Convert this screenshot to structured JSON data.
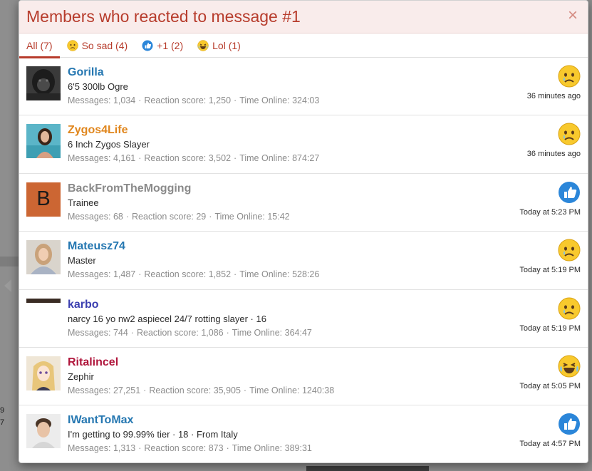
{
  "overlay": {
    "title": "Members who reacted to message #1",
    "close_glyph": "×"
  },
  "tabs": [
    {
      "label": "All (7)",
      "icon": null,
      "active": true
    },
    {
      "label": "So sad (4)",
      "icon": "sad-face-icon",
      "active": false
    },
    {
      "label": "+1 (2)",
      "icon": "thumbs-up-icon",
      "active": false
    },
    {
      "label": "Lol (1)",
      "icon": "laughing-face-icon",
      "active": false
    }
  ],
  "members": [
    {
      "name": "Gorilla",
      "name_color": "#2577b1",
      "title": "6'5 300lb Ogre",
      "messages_label": "Messages:",
      "messages": "1,034",
      "score_label": "Reaction score:",
      "score": "1,250",
      "online_label": "Time Online:",
      "online": "324:03",
      "reaction": "sad-face-icon",
      "time": "36 minutes ago"
    },
    {
      "name": "Zygos4Life",
      "name_color": "#e0861d",
      "title": "6 Inch Zygos Slayer",
      "messages_label": "Messages:",
      "messages": "4,161",
      "score_label": "Reaction score:",
      "score": "3,502",
      "online_label": "Time Online:",
      "online": "874:27",
      "reaction": "sad-face-icon",
      "time": "36 minutes ago"
    },
    {
      "name": "BackFromTheMogging",
      "name_color": "#8a8a8a",
      "title": "Trainee",
      "avatar_letter": "B",
      "messages_label": "Messages:",
      "messages": "68",
      "score_label": "Reaction score:",
      "score": "29",
      "online_label": "Time Online:",
      "online": "15:42",
      "reaction": "thumbs-up-icon",
      "time": "Today at 5:23 PM"
    },
    {
      "name": "Mateusz74",
      "name_color": "#2577b1",
      "title": "Master",
      "messages_label": "Messages:",
      "messages": "1,487",
      "score_label": "Reaction score:",
      "score": "1,852",
      "online_label": "Time Online:",
      "online": "528:26",
      "reaction": "sad-face-icon",
      "time": "Today at 5:19 PM"
    },
    {
      "name": "karbo",
      "name_color": "#3b3fb0",
      "title": "narcy 16 yo nw2 aspiecel 24/7 rotting slayer · 16",
      "messages_label": "Messages:",
      "messages": "744",
      "score_label": "Reaction score:",
      "score": "1,086",
      "online_label": "Time Online:",
      "online": "364:47",
      "reaction": "sad-face-icon",
      "time": "Today at 5:19 PM"
    },
    {
      "name": "Ritalincel",
      "name_color": "#b0163c",
      "title": "Zephir",
      "messages_label": "Messages:",
      "messages": "27,251",
      "score_label": "Reaction score:",
      "score": "35,905",
      "online_label": "Time Online:",
      "online": "1240:38",
      "reaction": "laughing-face-icon",
      "time": "Today at 5:05 PM"
    },
    {
      "name": "IWantToMax",
      "name_color": "#2577b1",
      "title": "I'm getting to 99.99% tier · 18 · From Italy",
      "messages_label": "Messages:",
      "messages": "1,313",
      "score_label": "Reaction score:",
      "score": "873",
      "online_label": "Time Online:",
      "online": "389:31",
      "reaction": "thumbs-up-icon",
      "time": "Today at 4:57 PM"
    }
  ],
  "background": {
    "side_text": [
      "9",
      "7"
    ]
  }
}
